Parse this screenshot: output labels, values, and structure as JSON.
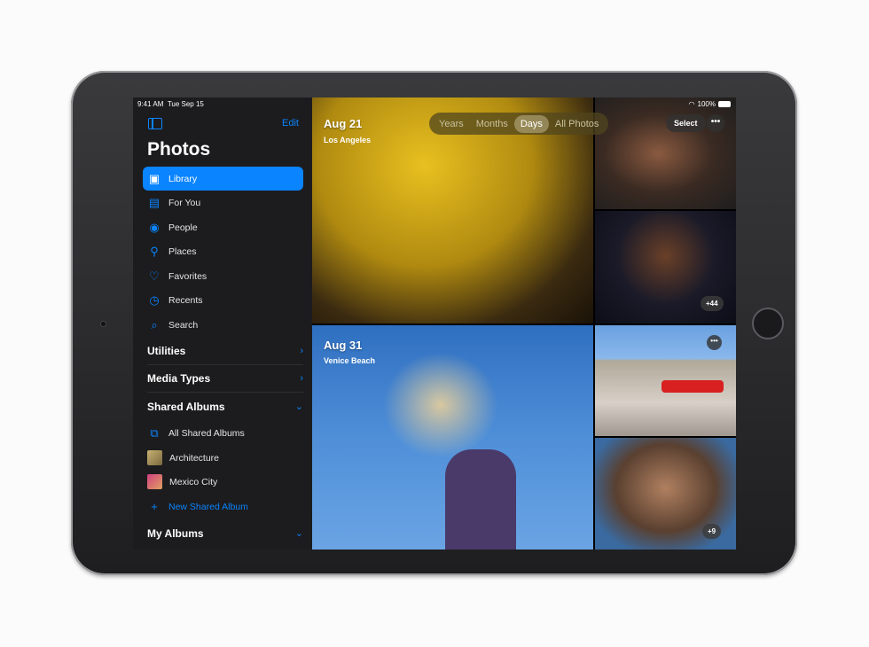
{
  "status": {
    "time": "9:41 AM",
    "date": "Tue Sep 15",
    "battery": "100%"
  },
  "sidebar": {
    "edit": "Edit",
    "title": "Photos",
    "items": [
      {
        "label": "Library",
        "icon": "photo-library-icon",
        "selected": true
      },
      {
        "label": "For You",
        "icon": "for-you-icon"
      },
      {
        "label": "People",
        "icon": "person-circle-icon"
      },
      {
        "label": "Places",
        "icon": "map-pin-icon"
      },
      {
        "label": "Favorites",
        "icon": "heart-icon"
      },
      {
        "label": "Recents",
        "icon": "clock-icon"
      },
      {
        "label": "Search",
        "icon": "search-icon"
      }
    ],
    "sections": {
      "utilities": "Utilities",
      "media_types": "Media Types",
      "shared_albums": "Shared Albums",
      "my_albums": "My Albums"
    },
    "shared": [
      {
        "label": "All Shared Albums",
        "icon": "shared-albums-icon"
      },
      {
        "label": "Architecture"
      },
      {
        "label": "Mexico City"
      }
    ],
    "new_shared": "New Shared Album"
  },
  "toolbar": {
    "tabs": [
      "Years",
      "Months",
      "Days",
      "All Photos"
    ],
    "active": "Days",
    "select": "Select",
    "more": "•••"
  },
  "days": [
    {
      "date": "Aug 21",
      "location": "Los Angeles",
      "badge": "+44"
    },
    {
      "date": "Aug 31",
      "location": "Venice Beach",
      "badge": "+9"
    }
  ],
  "colors": {
    "accent": "#0a84ff",
    "sidebar": "#1c1c1e"
  }
}
